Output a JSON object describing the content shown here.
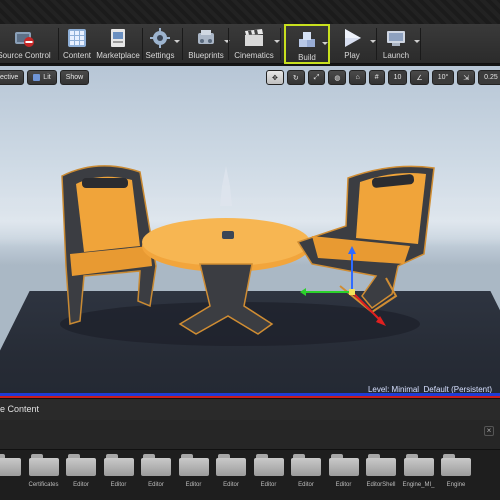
{
  "toolbar": {
    "buttons": [
      {
        "id": "source-control",
        "label": "Source Control",
        "icon": "source-control-icon"
      },
      {
        "id": "content",
        "label": "Content",
        "icon": "content-icon"
      },
      {
        "id": "marketplace",
        "label": "Marketplace",
        "icon": "marketplace-icon"
      },
      {
        "id": "settings",
        "label": "Settings",
        "icon": "settings-icon"
      },
      {
        "id": "blueprints",
        "label": "Blueprints",
        "icon": "blueprints-icon"
      },
      {
        "id": "cinematics",
        "label": "Cinematics",
        "icon": "cinematics-icon"
      },
      {
        "id": "build",
        "label": "Build",
        "icon": "build-icon"
      },
      {
        "id": "play",
        "label": "Play",
        "icon": "play-icon"
      },
      {
        "id": "launch",
        "label": "Launch",
        "icon": "launch-icon"
      }
    ],
    "highlight_color": "#c8e01e"
  },
  "viewport": {
    "perspective_label": "ective",
    "lit_label": "Lit",
    "show_label": "Show",
    "grid_snap": "10",
    "rotation_snap": "10°",
    "scale_snap": "0.25",
    "camera_speed": "4",
    "level_text": "Level:  Minimal_Default (Persistent)"
  },
  "content_browser": {
    "title": "e Content",
    "folders": [
      {
        "label": ""
      },
      {
        "label": "Certificates"
      },
      {
        "label": "Editor"
      },
      {
        "label": "Editor\nBlueprint"
      },
      {
        "label": "Editor\nKismet"
      },
      {
        "label": "Editor\nLandscape"
      },
      {
        "label": "Editor\n..."
      },
      {
        "label": "Editor\n..."
      },
      {
        "label": "Editor\n..."
      },
      {
        "label": "Editor"
      },
      {
        "label": "EditorShell\nMaterials"
      },
      {
        "label": "Engine_MI_\nDefaults"
      },
      {
        "label": "Engine\nDamage"
      }
    ]
  }
}
